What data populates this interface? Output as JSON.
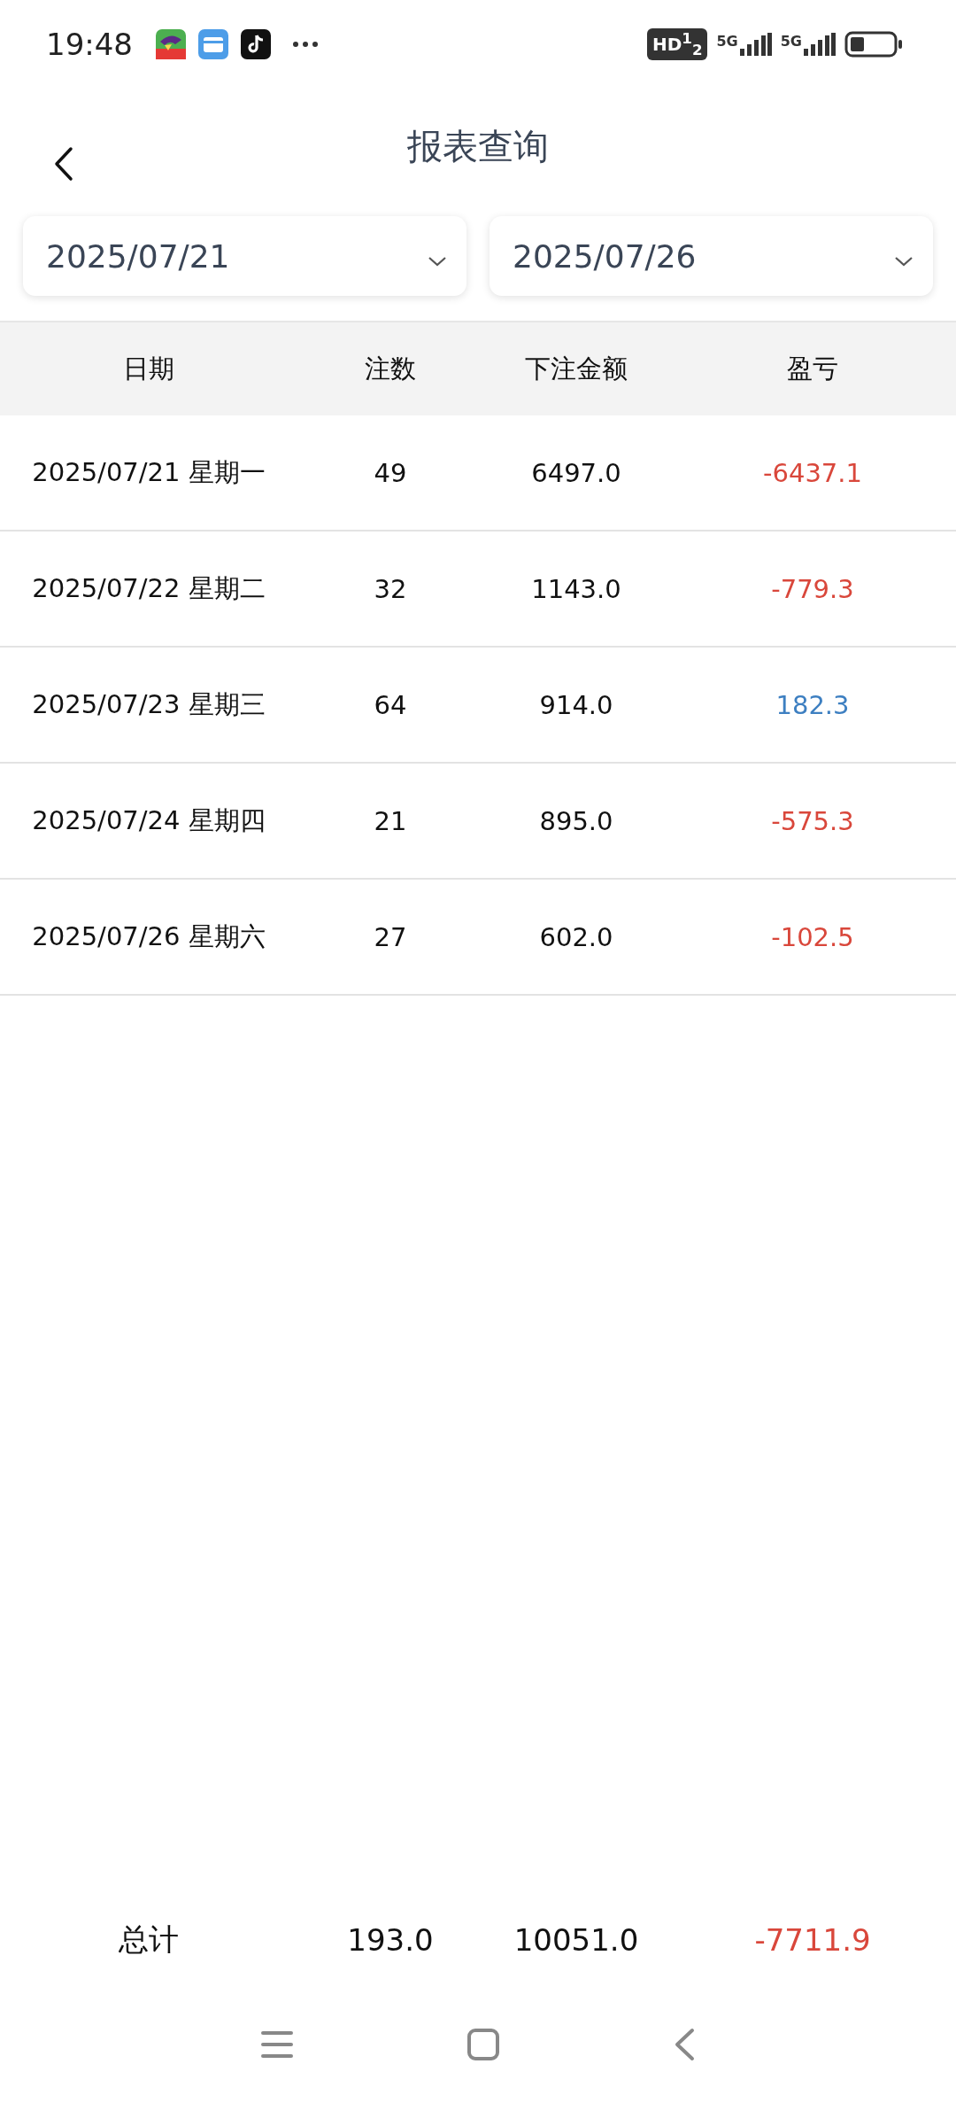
{
  "status_bar": {
    "time": "19:48",
    "hd_badge": "HD$^{1}$$_{2}$",
    "networks": [
      "5G",
      "5G"
    ]
  },
  "header": {
    "title": "报表查询"
  },
  "date_range": {
    "start": "2025/07/21",
    "end": "2025/07/26"
  },
  "table": {
    "columns": [
      "日期",
      "注数",
      "下注金额",
      "盈亏"
    ],
    "rows": [
      {
        "date": "2025/07/21 星期一",
        "count": "49",
        "amount": "6497.0",
        "profit": "-6437.1",
        "color": "#d9473b"
      },
      {
        "date": "2025/07/22 星期二",
        "count": "32",
        "amount": "1143.0",
        "profit": "-779.3",
        "color": "#d9473b"
      },
      {
        "date": "2025/07/23 星期三",
        "count": "64",
        "amount": "914.0",
        "profit": "182.3",
        "color": "#3d7fc1"
      },
      {
        "date": "2025/07/24 星期四",
        "count": "21",
        "amount": "895.0",
        "profit": "-575.3",
        "color": "#d9473b"
      },
      {
        "date": "2025/07/26 星期六",
        "count": "27",
        "amount": "602.0",
        "profit": "-102.5",
        "color": "#d9473b"
      }
    ]
  },
  "total": {
    "label": "总计",
    "count": "193.0",
    "amount": "10051.0",
    "profit": "-7711.9",
    "color": "#d9473b"
  }
}
